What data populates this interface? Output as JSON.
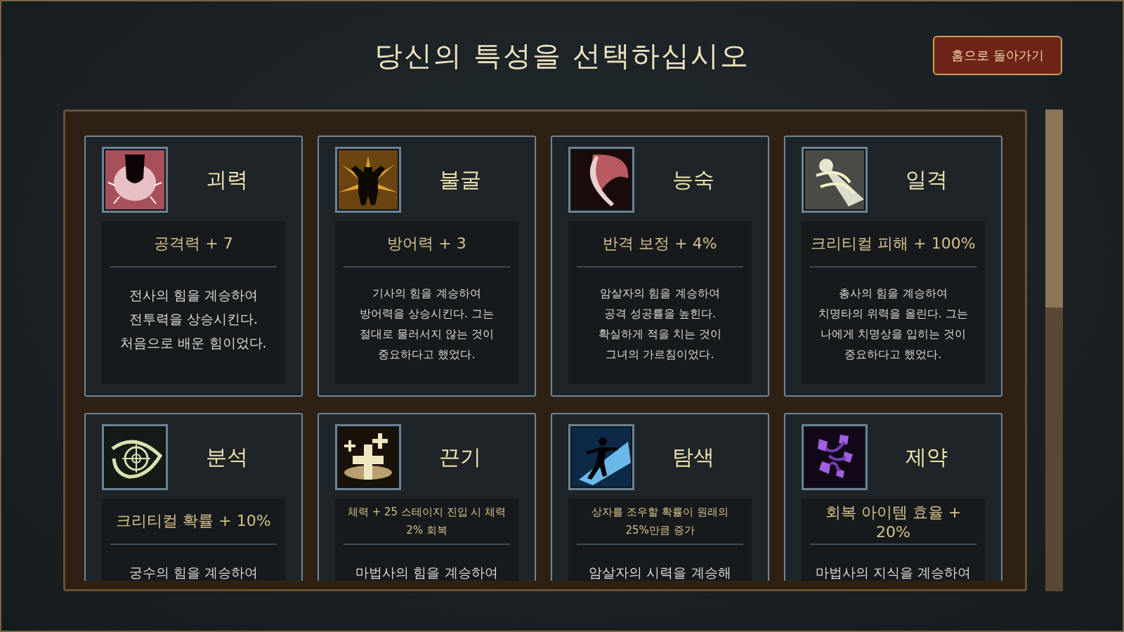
{
  "title": "당신의 특성을 선택하십시오",
  "home_button": "홈으로 돌아가기",
  "traits": [
    {
      "name": "괴력",
      "stat": "공격력 + 7",
      "description": "전사의 힘을 계승하여\n전투력을 상승시킨다.\n처음으로 배운 힘이었다."
    },
    {
      "name": "불굴",
      "stat": "방어력 + 3",
      "description": "기사의 힘을 계승하여\n방어력을 상승시킨다. 그는\n절대로 물러서지 않는 것이\n중요하다고 했었다."
    },
    {
      "name": "능숙",
      "stat": "반격 보정 + 4%",
      "description": "암살자의 힘을 계승하여\n공격 성공률을 높힌다.\n확실하게 적을 치는 것이\n그녀의 가르침이었다."
    },
    {
      "name": "일격",
      "stat": "크리티컬 피해 + 100%",
      "description": "총사의 힘을 계승하여\n치명타의 위력을 올린다. 그는\n나에게 치명상을 입히는 것이\n중요하다고 했었다."
    },
    {
      "name": "분석",
      "stat": "크리티컬 확률 + 10%",
      "description": "궁수의 힘을 계승하여"
    },
    {
      "name": "끈기",
      "stat": "체력 + 25 스테이지 진입 시 체력\n2% 회복",
      "description": "마법사의 힘을 계승하여"
    },
    {
      "name": "탐색",
      "stat": "상자를 조우할 확률이 원래의\n25%만큼 증가",
      "description": "암살자의 시력을 계승해"
    },
    {
      "name": "제약",
      "stat": "회복 아이템 효율 + 20%",
      "description": "마법사의 지식을 계승하여"
    }
  ]
}
